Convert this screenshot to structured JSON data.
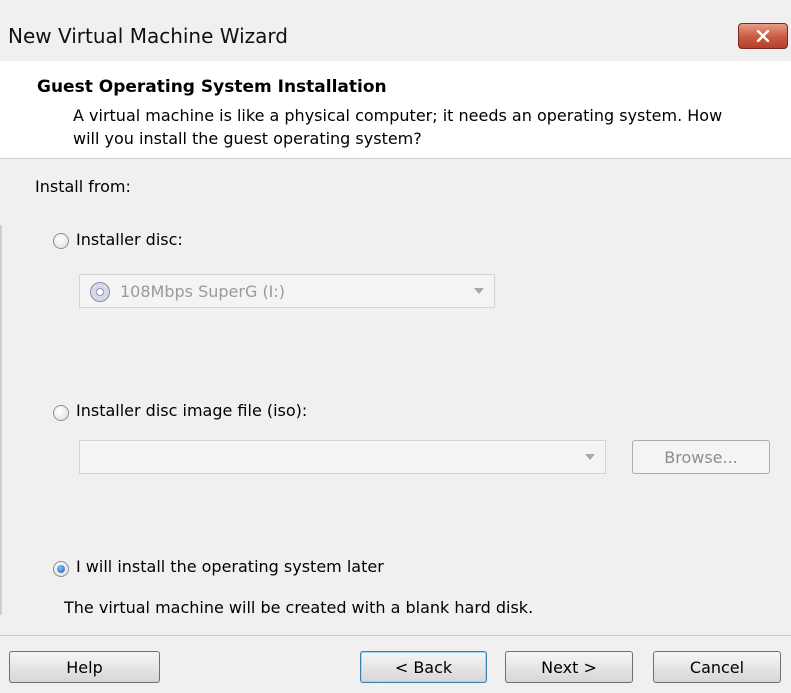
{
  "window": {
    "title": "New Virtual Machine Wizard",
    "close_icon": "close-x-icon"
  },
  "header": {
    "title": "Guest Operating System Installation",
    "description": "A virtual machine is like a physical computer; it needs an operating system. How will you install the guest operating system?"
  },
  "install": {
    "label": "Install from:",
    "options": [
      {
        "label": "Installer disc:",
        "checked": false
      },
      {
        "label": "Installer disc image file (iso):",
        "checked": false
      },
      {
        "label": "I will install the operating system later",
        "checked": true
      }
    ],
    "disc_drive": {
      "value": "108Mbps SuperG (I:)",
      "icon": "disc-icon",
      "enabled": false
    },
    "iso_path": {
      "value": "",
      "enabled": false
    },
    "browse_label": "Browse...",
    "later_note": "The virtual machine will be created with a blank hard disk."
  },
  "buttons": {
    "help": "Help",
    "back": "< Back",
    "next": "Next >",
    "cancel": "Cancel"
  }
}
